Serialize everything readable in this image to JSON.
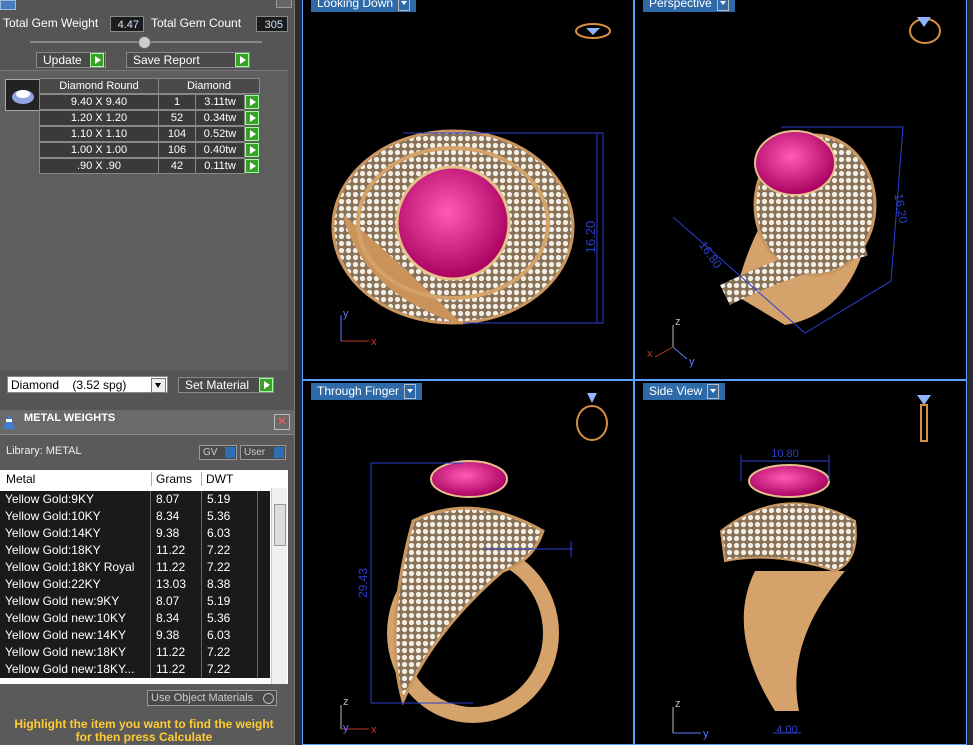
{
  "gem_summary": {
    "total_weight_label": "Total Gem Weight",
    "total_weight_value": "4.47",
    "total_count_label": "Total Gem Count",
    "total_count_value": "305"
  },
  "actions": {
    "update_label": "Update",
    "save_report_label": "Save Report"
  },
  "gem_table": {
    "headers": [
      "Diamond Round",
      "Diamond"
    ],
    "rows": [
      {
        "size": "9.40 X 9.40",
        "count": "1",
        "weight": "3.11tw"
      },
      {
        "size": "1.20 X 1.20",
        "count": "52",
        "weight": "0.34tw"
      },
      {
        "size": "1.10 X 1.10",
        "count": "104",
        "weight": "0.52tw"
      },
      {
        "size": "1.00 X 1.00",
        "count": "106",
        "weight": "0.40tw"
      },
      {
        "size": ".90 X .90",
        "count": "42",
        "weight": "0.11tw"
      }
    ]
  },
  "material": {
    "selected": "Diamond    (3.52 spg)",
    "set_material_label": "Set Material"
  },
  "metal_weights": {
    "title": "METAL WEIGHTS",
    "library_label": "Library: METAL",
    "gv_label": "GV",
    "user_label": "User",
    "columns": [
      "Metal",
      "Grams",
      "DWT"
    ],
    "rows": [
      {
        "metal": "Yellow Gold:9KY",
        "grams": "8.07",
        "dwt": "5.19"
      },
      {
        "metal": "Yellow Gold:10KY",
        "grams": "8.34",
        "dwt": "5.36"
      },
      {
        "metal": "Yellow Gold:14KY",
        "grams": "9.38",
        "dwt": "6.03"
      },
      {
        "metal": "Yellow Gold:18KY",
        "grams": "11.22",
        "dwt": "7.22"
      },
      {
        "metal": "Yellow Gold:18KY Royal",
        "grams": "11.22",
        "dwt": "7.22"
      },
      {
        "metal": "Yellow Gold:22KY",
        "grams": "13.03",
        "dwt": "8.38"
      },
      {
        "metal": "Yellow Gold new:9KY",
        "grams": "8.07",
        "dwt": "5.19"
      },
      {
        "metal": "Yellow Gold new:10KY",
        "grams": "8.34",
        "dwt": "5.36"
      },
      {
        "metal": "Yellow Gold new:14KY",
        "grams": "9.38",
        "dwt": "6.03"
      },
      {
        "metal": "Yellow Gold new:18KY",
        "grams": "11.22",
        "dwt": "7.22"
      },
      {
        "metal": "Yellow Gold new:18KY...",
        "grams": "11.22",
        "dwt": "7.22"
      }
    ],
    "use_object_materials_label": "Use Object Materials",
    "hint": "Highlight the item you want to find the weight for then press Calculate"
  },
  "viewports": {
    "top_left_label": "Looking Down",
    "top_right_label": "Perspective",
    "bottom_left_label": "Through Finger",
    "bottom_right_label": "Side View",
    "dim_top_left": "16.20",
    "dim_perspective_a": "16.20",
    "dim_perspective_b": "16.80",
    "dim_through_finger": "29.43",
    "dim_side_top": "10.80",
    "dim_side_bottom": "4.00"
  },
  "axes": {
    "x": "x",
    "y": "y",
    "z": "z"
  },
  "colors": {
    "accent": "#2e6aa8",
    "gem": "#d4137a",
    "gold": "#d6a25c",
    "hint_text": "#ffcc33",
    "dimension": "#2a3fd0",
    "button_green": "#3aa02a"
  }
}
